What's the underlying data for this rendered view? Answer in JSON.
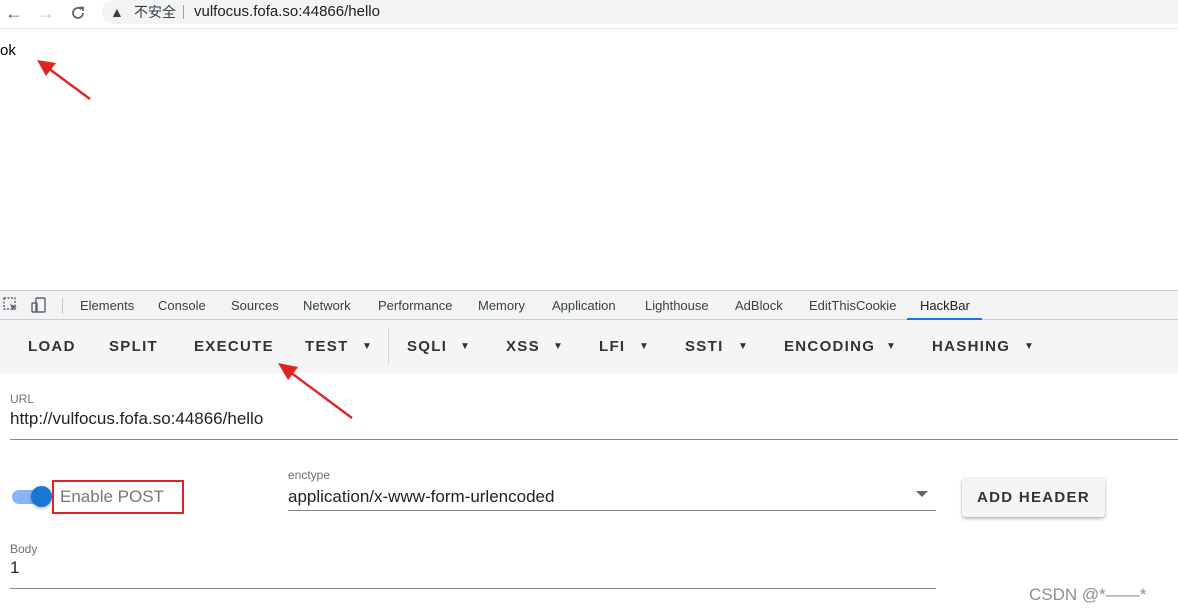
{
  "browser": {
    "security_label": "不安全",
    "url": "vulfocus.fofa.so:44866/hello"
  },
  "content": {
    "text": "ok"
  },
  "devtools": {
    "tabs": [
      "Elements",
      "Console",
      "Sources",
      "Network",
      "Performance",
      "Memory",
      "Application",
      "Lighthouse",
      "AdBlock",
      "EditThisCookie",
      "HackBar"
    ],
    "active_tab": "HackBar"
  },
  "hackbar": {
    "toolbar": {
      "load": "LOAD",
      "split": "SPLIT",
      "execute": "EXECUTE",
      "test": "TEST",
      "sqli": "SQLI",
      "xss": "XSS",
      "lfi": "LFI",
      "ssti": "SSTI",
      "encoding": "ENCODING",
      "hashing": "HASHING"
    },
    "url_label": "URL",
    "url_value": "http://vulfocus.fofa.so:44866/hello",
    "enable_post_label": "Enable POST",
    "enable_post_on": true,
    "enctype_label": "enctype",
    "enctype_value": "application/x-www-form-urlencoded",
    "add_header": "ADD HEADER",
    "body_label": "Body",
    "body_value": "1"
  },
  "watermark": "CSDN @*——*",
  "colors": {
    "accent": "#1a73e8",
    "toggle": "#1976d2",
    "annotation": "#e02424"
  }
}
